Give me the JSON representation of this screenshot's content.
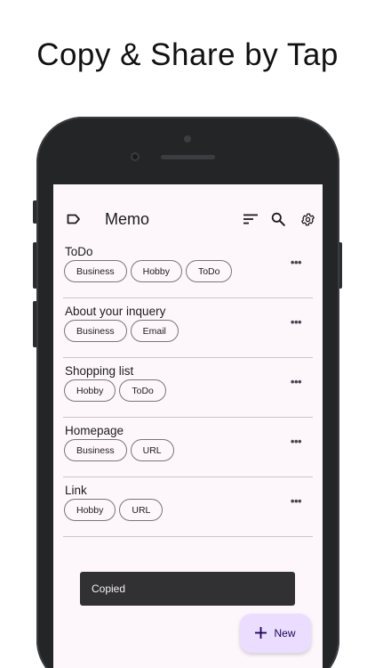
{
  "headline": "Copy & Share by Tap",
  "app": {
    "title": "Memo",
    "icons": {
      "label": "label-outline-icon",
      "sort": "sort-icon",
      "search": "search-icon",
      "settings": "gear-icon"
    }
  },
  "memos": [
    {
      "title": "ToDo",
      "tags": [
        "Business",
        "Hobby",
        "ToDo"
      ]
    },
    {
      "title": "About your inquery",
      "tags": [
        "Business",
        "Email"
      ]
    },
    {
      "title": "Shopping list",
      "tags": [
        "Hobby",
        "ToDo"
      ]
    },
    {
      "title": "Homepage",
      "tags": [
        "Business",
        "URL"
      ]
    },
    {
      "title": "Link",
      "tags": [
        "Hobby",
        "URL"
      ]
    }
  ],
  "more_label": "•••",
  "snackbar": {
    "text": "Copied"
  },
  "fab": {
    "label": "New",
    "icon": "plus-icon"
  },
  "colors": {
    "screen_background": "#fdf7fc",
    "fab_background": "#eaddff",
    "snackbar_background": "#313033"
  }
}
